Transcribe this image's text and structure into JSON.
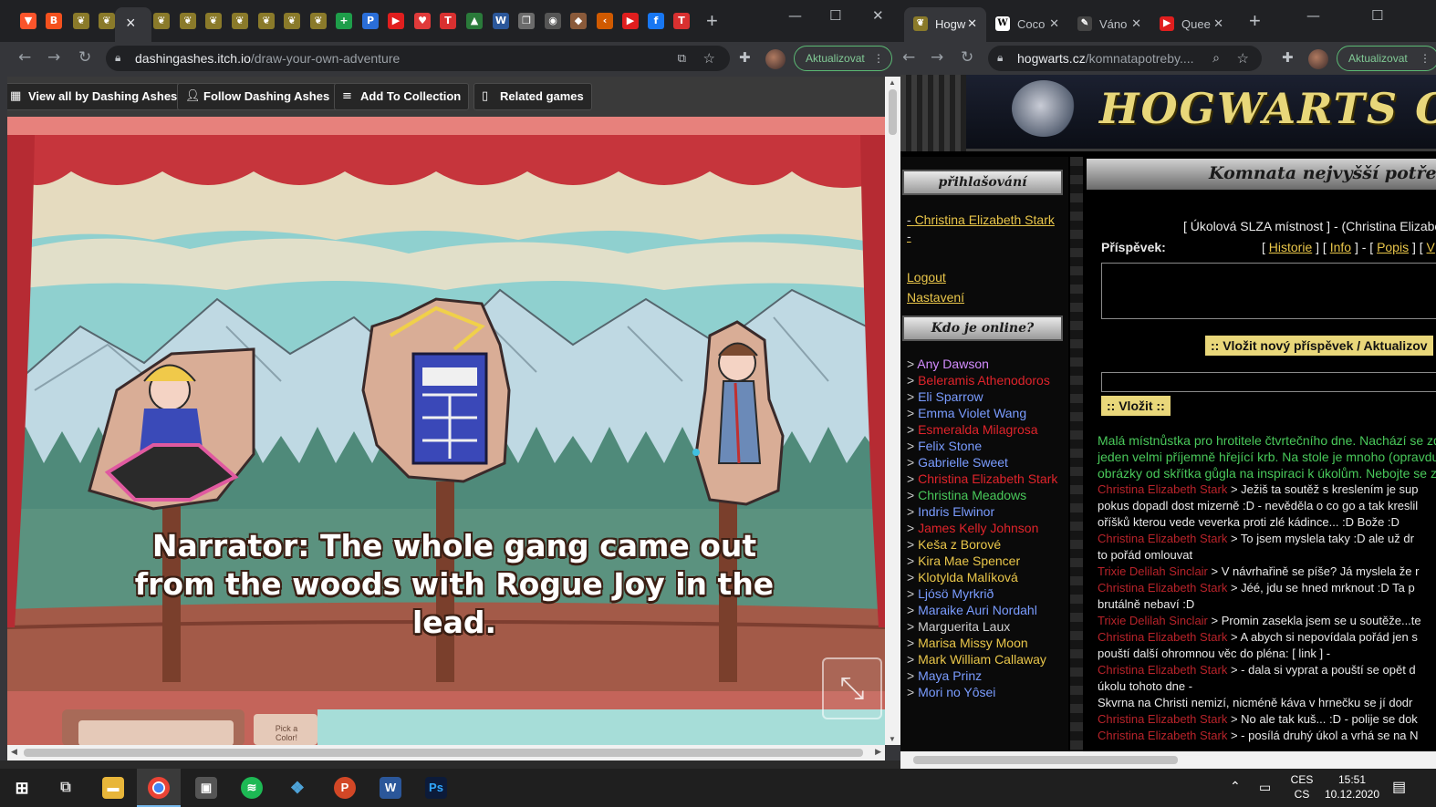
{
  "left_window": {
    "tabs": {
      "active_close": "×",
      "new_tab": "+"
    },
    "window_controls": {
      "minimize": "—",
      "maximize": "☐",
      "close": "✕"
    },
    "address": {
      "host": "dashingashes.itch.io",
      "path": "/draw-your-own-adventure"
    },
    "update_label": "Aktualizovat",
    "itch_buttons": [
      {
        "label": "View all by Dashing Ashes",
        "icon": "grid-icon"
      },
      {
        "label": "Follow Dashing Ashes",
        "icon": "follow-user-icon"
      },
      {
        "label": "Add To Collection",
        "icon": "add-list-icon"
      },
      {
        "label": "Related games",
        "icon": "map-icon"
      }
    ],
    "narration": "Narrator: The whole gang came out from the woods with Rogue Joy in the lead.",
    "pick_color": "Pick a Color!"
  },
  "right_window": {
    "tabs": [
      {
        "label": "Hogw",
        "icon": "hogwarts-icon",
        "active": true
      },
      {
        "label": "Coco",
        "icon": "wikipedia-icon",
        "active": false
      },
      {
        "label": "Váno",
        "icon": "pen-icon",
        "active": false
      },
      {
        "label": "Quee",
        "icon": "youtube-icon",
        "active": false
      }
    ],
    "address": {
      "host": "hogwarts.cz",
      "path": "/komnatapotreby...."
    },
    "update_label": "Aktualizovat",
    "site_title": "HOGWARTS ON",
    "sidebar": {
      "login_heading": "přihlašování",
      "user": "Christina Elizabeth Stark",
      "logout": "Logout",
      "settings": "Nastavení",
      "online_heading": "Kdo je online?",
      "online": [
        {
          "name": "Any Dawson",
          "color": "purple"
        },
        {
          "name": "Beleramis Athenodoros",
          "color": "red"
        },
        {
          "name": "Eli Sparrow",
          "color": "blue"
        },
        {
          "name": "Emma Violet Wang",
          "color": "blue"
        },
        {
          "name": "Esmeralda Milagrosa",
          "color": "red"
        },
        {
          "name": "Felix Stone",
          "color": "blue"
        },
        {
          "name": "Gabrielle Sweet",
          "color": "blue"
        },
        {
          "name": "Christina Elizabeth Stark",
          "color": "red"
        },
        {
          "name": "Christina Meadows",
          "color": "green"
        },
        {
          "name": "Indris Elwinor",
          "color": "blue"
        },
        {
          "name": "James Kelly Johnson",
          "color": "red"
        },
        {
          "name": "Keša z Borové",
          "color": "yellow"
        },
        {
          "name": "Kira Mae Spencer",
          "color": "yellow"
        },
        {
          "name": "Klotylda Malíková",
          "color": "yellow"
        },
        {
          "name": "Ljósö Myrkrið",
          "color": "blue"
        },
        {
          "name": "Maraike Auri Nordahl",
          "color": "blue"
        },
        {
          "name": "Marguerita Laux",
          "color": "white"
        },
        {
          "name": "Marisa Missy Moon",
          "color": "yellow"
        },
        {
          "name": "Mark William Callaway",
          "color": "yellow"
        },
        {
          "name": "Maya Prinz",
          "color": "blue"
        },
        {
          "name": "Mori no Yôsei",
          "color": "blue"
        }
      ]
    },
    "main": {
      "heading": "Komnata nejvyšší potřeb",
      "room_line": "[ Úkolová SLZA místnost ] - (Christina Elizabe",
      "post_label": "Příspěvek:",
      "links": {
        "history": "Historie",
        "info": "Info",
        "desc": "Popis",
        "v": "V"
      },
      "post_button": ":: Vložit nový příspěvek / Aktualizov",
      "insert_button": ":: Vložit ::",
      "intro": [
        "Malá místnůstka pro hrotitele čtvrtečního dne. Nachází se zd",
        "jeden velmi příjemně hřející krb. Na stole je mnoho (opravdu",
        "obrázky od skřítka gůgla na inspiraci k úkolům. Nebojte se z"
      ],
      "messages": [
        {
          "who": "Christina Elizabeth Stark",
          "text": " > Ježiš ta soutěž s kreslením je sup"
        },
        {
          "who": "",
          "text": "pokus dopadl dost mizerně :D - nevěděla o co go a tak kreslil"
        },
        {
          "who": "",
          "text": "oříšků kterou vede veverka proti zlé kádince... :D Bože :D"
        },
        {
          "who": "Christina Elizabeth Stark",
          "text": " > To jsem myslela taky :D ale už dr"
        },
        {
          "who": "",
          "text": "to pořád omlouvat"
        },
        {
          "who": "Trixie Delilah Sinclair",
          "text": " > V návrhařině se píše? Já myslela že r"
        },
        {
          "who": "Christina Elizabeth Stark",
          "text": " > Jéé, jdu se hned mrknout :D Ta p"
        },
        {
          "who": "",
          "text": "brutálně nebaví :D"
        },
        {
          "who": "Trixie Delilah Sinclair",
          "text": " > Promin zasekla jsem se u soutěže...te"
        },
        {
          "who": "Christina Elizabeth Stark",
          "text": " > A abych si nepovídala pořád jen s"
        },
        {
          "who": "",
          "text": "pouští další ohromnou věc do pléna: [ link ] -"
        },
        {
          "who": "Christina Elizabeth Stark",
          "text": " > - dala si vyprat a pouští se opět d"
        },
        {
          "who": "",
          "text": "úkolu tohoto dne -"
        },
        {
          "who": "",
          "text": "Skvrna na Christi nemizí, nicméně káva v hrnečku se jí dodr"
        },
        {
          "who": "Christina Elizabeth Stark",
          "text": " > No ale tak kuš... :D - polije se dok"
        },
        {
          "who": "Christina Elizabeth Stark",
          "text": " > - posílá druhý úkol a vrhá se na N"
        }
      ]
    }
  },
  "taskbar": {
    "language": {
      "top": "CES",
      "bottom": "CS"
    },
    "time": "15:51",
    "date": "10.12.2020",
    "apps": [
      {
        "icon": "explorer-icon"
      },
      {
        "icon": "chrome-icon"
      },
      {
        "icon": "store-icon"
      },
      {
        "icon": "spotify-icon"
      },
      {
        "icon": "kodi-icon"
      },
      {
        "icon": "powerpoint-icon"
      },
      {
        "icon": "word-icon"
      },
      {
        "icon": "photoshop-icon"
      }
    ]
  }
}
